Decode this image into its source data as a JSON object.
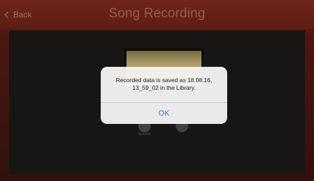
{
  "header": {
    "back_label": "Back",
    "title": "Song Recording"
  },
  "panel": {
    "knob_label": "Synchro"
  },
  "alert": {
    "message_line1": "Recorded data is saved as 18.08.16,",
    "message_line2": "13_59_02 in the Library.",
    "ok_label": "OK"
  },
  "colors": {
    "accent_red": "#6e2419",
    "link_blue": "#2a7bf0"
  },
  "icons": {
    "back": "chevron-left-icon"
  }
}
